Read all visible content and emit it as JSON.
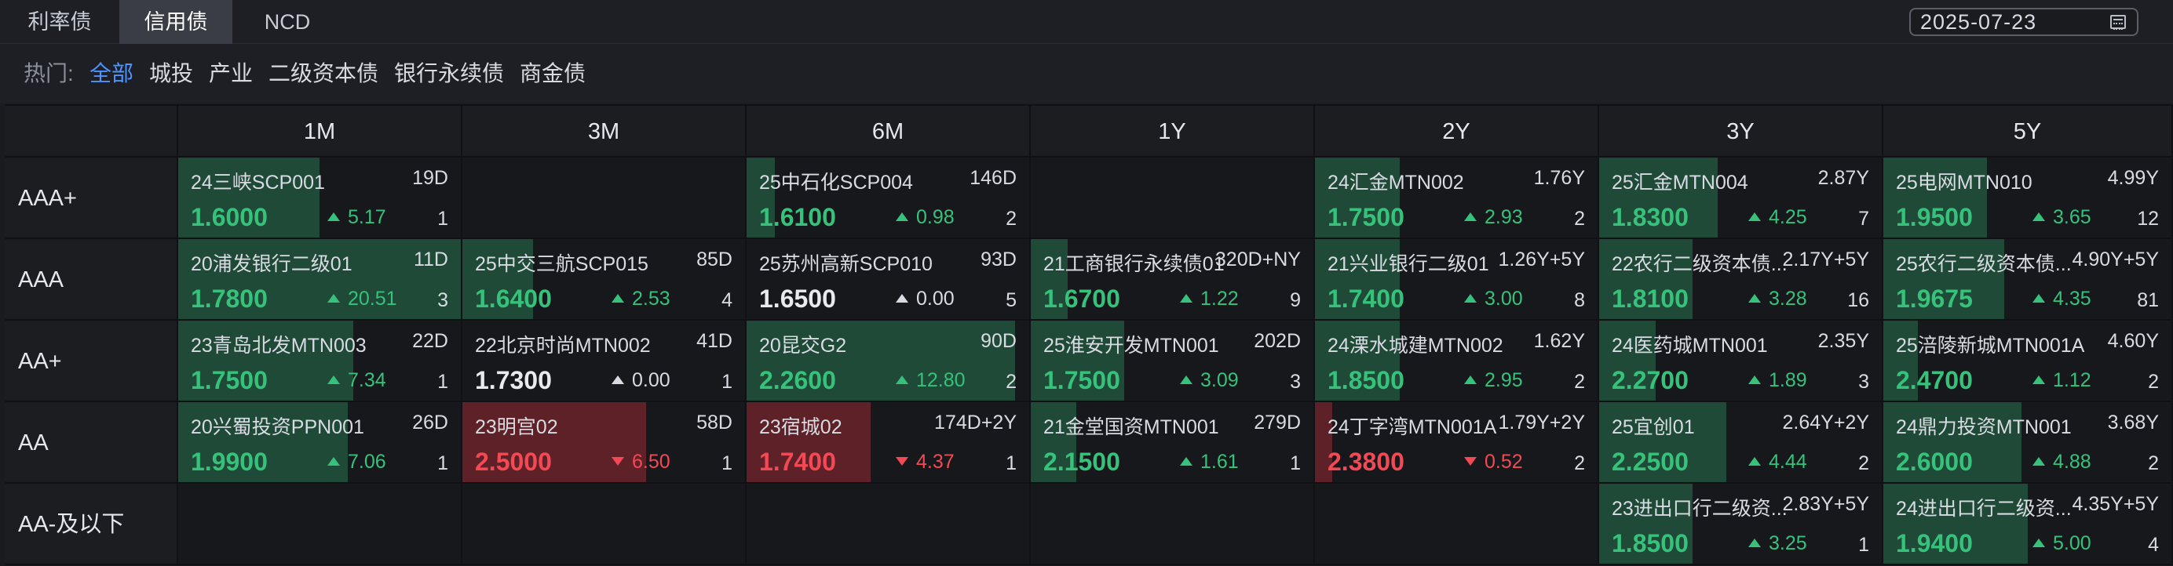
{
  "tabs": [
    {
      "label": "利率债",
      "active": false
    },
    {
      "label": "信用债",
      "active": true
    },
    {
      "label": "NCD",
      "active": false
    }
  ],
  "date": {
    "value": "2025-07-23",
    "icon": "calendar-icon"
  },
  "filter": {
    "label": "热门:",
    "items": [
      {
        "label": "全部",
        "active": true
      },
      {
        "label": "城投",
        "active": false
      },
      {
        "label": "产业",
        "active": false
      },
      {
        "label": "二级资本债",
        "active": false
      },
      {
        "label": "银行永续债",
        "active": false
      },
      {
        "label": "商金债",
        "active": false
      }
    ]
  },
  "colors": {
    "up": "#36c27a",
    "down": "#f24955",
    "flat": "#e8eaee",
    "active_filter": "#4c94ff"
  },
  "columns": [
    "1M",
    "3M",
    "6M",
    "1Y",
    "2Y",
    "3Y",
    "5Y"
  ],
  "rows": [
    {
      "label": "AAA+",
      "cells": [
        {
          "bond": "24三峡SCP001",
          "term": "19D",
          "rate": "1.6000",
          "change": "5.17",
          "count": "1",
          "dir": "up",
          "fill": 0.5
        },
        null,
        {
          "bond": "25中石化SCP004",
          "term": "146D",
          "rate": "1.6100",
          "change": "0.98",
          "count": "2",
          "dir": "up",
          "fill": 0.1
        },
        null,
        {
          "bond": "24汇金MTN002",
          "term": "1.76Y",
          "rate": "1.7500",
          "change": "2.93",
          "count": "2",
          "dir": "up",
          "fill": 0.3
        },
        {
          "bond": "25汇金MTN004",
          "term": "2.87Y",
          "rate": "1.8300",
          "change": "4.25",
          "count": "7",
          "dir": "up",
          "fill": 0.42
        },
        {
          "bond": "25电网MTN010",
          "term": "4.99Y",
          "rate": "1.9500",
          "change": "3.65",
          "count": "12",
          "dir": "up",
          "fill": 0.36
        }
      ]
    },
    {
      "label": "AAA",
      "cells": [
        {
          "bond": "20浦发银行二级01",
          "term": "11D",
          "rate": "1.7800",
          "change": "20.51",
          "count": "3",
          "dir": "up",
          "fill": 1.0
        },
        {
          "bond": "25中交三航SCP015",
          "term": "85D",
          "rate": "1.6400",
          "change": "2.53",
          "count": "4",
          "dir": "up",
          "fill": 0.25
        },
        {
          "bond": "25苏州高新SCP010",
          "term": "93D",
          "rate": "1.6500",
          "change": "0.00",
          "count": "5",
          "dir": "flat",
          "fill": 0
        },
        {
          "bond": "21工商银行永续债01",
          "term": "320D+NY",
          "rate": "1.6700",
          "change": "1.22",
          "count": "9",
          "dir": "up",
          "fill": 0.13
        },
        {
          "bond": "21兴业银行二级01",
          "term": "1.26Y+5Y",
          "rate": "1.7400",
          "change": "3.00",
          "count": "8",
          "dir": "up",
          "fill": 0.3
        },
        {
          "bond": "22农行二级资本债...",
          "term": "2.17Y+5Y",
          "rate": "1.8100",
          "change": "3.28",
          "count": "16",
          "dir": "up",
          "fill": 0.33
        },
        {
          "bond": "25农行二级资本债...",
          "term": "4.90Y+5Y",
          "rate": "1.9675",
          "change": "4.35",
          "count": "81",
          "dir": "up",
          "fill": 0.42
        }
      ]
    },
    {
      "label": "AA+",
      "cells": [
        {
          "bond": "23青岛北发MTN003",
          "term": "22D",
          "rate": "1.7500",
          "change": "7.34",
          "count": "1",
          "dir": "up",
          "fill": 0.62
        },
        {
          "bond": "22北京时尚MTN002",
          "term": "41D",
          "rate": "1.7300",
          "change": "0.00",
          "count": "1",
          "dir": "flat",
          "fill": 0
        },
        {
          "bond": "20昆交G2",
          "term": "90D",
          "rate": "2.2600",
          "change": "12.80",
          "count": "2",
          "dir": "up",
          "fill": 0.95
        },
        {
          "bond": "25淮安开发MTN001",
          "term": "202D",
          "rate": "1.7500",
          "change": "3.09",
          "count": "3",
          "dir": "up",
          "fill": 0.33
        },
        {
          "bond": "24溧水城建MTN002",
          "term": "1.62Y",
          "rate": "1.8500",
          "change": "2.95",
          "count": "2",
          "dir": "up",
          "fill": 0.3
        },
        {
          "bond": "24医药城MTN001",
          "term": "2.35Y",
          "rate": "2.2700",
          "change": "1.89",
          "count": "3",
          "dir": "up",
          "fill": 0.2
        },
        {
          "bond": "25涪陵新城MTN001A",
          "term": "4.60Y",
          "rate": "2.4700",
          "change": "1.12",
          "count": "2",
          "dir": "up",
          "fill": 0.12
        }
      ]
    },
    {
      "label": "AA",
      "cells": [
        {
          "bond": "20兴蜀投资PPN001",
          "term": "26D",
          "rate": "1.9900",
          "change": "7.06",
          "count": "1",
          "dir": "up",
          "fill": 0.6
        },
        {
          "bond": "23明宫02",
          "term": "58D",
          "rate": "2.5000",
          "change": "6.50",
          "count": "1",
          "dir": "down",
          "fill": 0.65
        },
        {
          "bond": "23宿城02",
          "term": "174D+2Y",
          "rate": "1.7400",
          "change": "4.37",
          "count": "1",
          "dir": "down",
          "fill": 0.44
        },
        {
          "bond": "21金堂国资MTN001",
          "term": "279D",
          "rate": "2.1500",
          "change": "1.61",
          "count": "1",
          "dir": "up",
          "fill": 0.16
        },
        {
          "bond": "24丁字湾MTN001A",
          "term": "1.79Y+2Y",
          "rate": "2.3800",
          "change": "0.52",
          "count": "2",
          "dir": "down",
          "fill": 0.06
        },
        {
          "bond": "25宜创01",
          "term": "2.64Y+2Y",
          "rate": "2.2500",
          "change": "4.44",
          "count": "2",
          "dir": "up",
          "fill": 0.45
        },
        {
          "bond": "24鼎力投资MTN001",
          "term": "3.68Y",
          "rate": "2.6000",
          "change": "4.88",
          "count": "2",
          "dir": "up",
          "fill": 0.48
        }
      ]
    },
    {
      "label": "AA-及以下",
      "cells": [
        null,
        null,
        null,
        null,
        null,
        {
          "bond": "23进出口行二级资...",
          "term": "2.83Y+5Y",
          "rate": "1.8500",
          "change": "3.25",
          "count": "1",
          "dir": "up",
          "fill": 0.33
        },
        {
          "bond": "24进出口行二级资...",
          "term": "4.35Y+5Y",
          "rate": "1.9400",
          "change": "5.00",
          "count": "4",
          "dir": "up",
          "fill": 0.5
        }
      ]
    }
  ]
}
